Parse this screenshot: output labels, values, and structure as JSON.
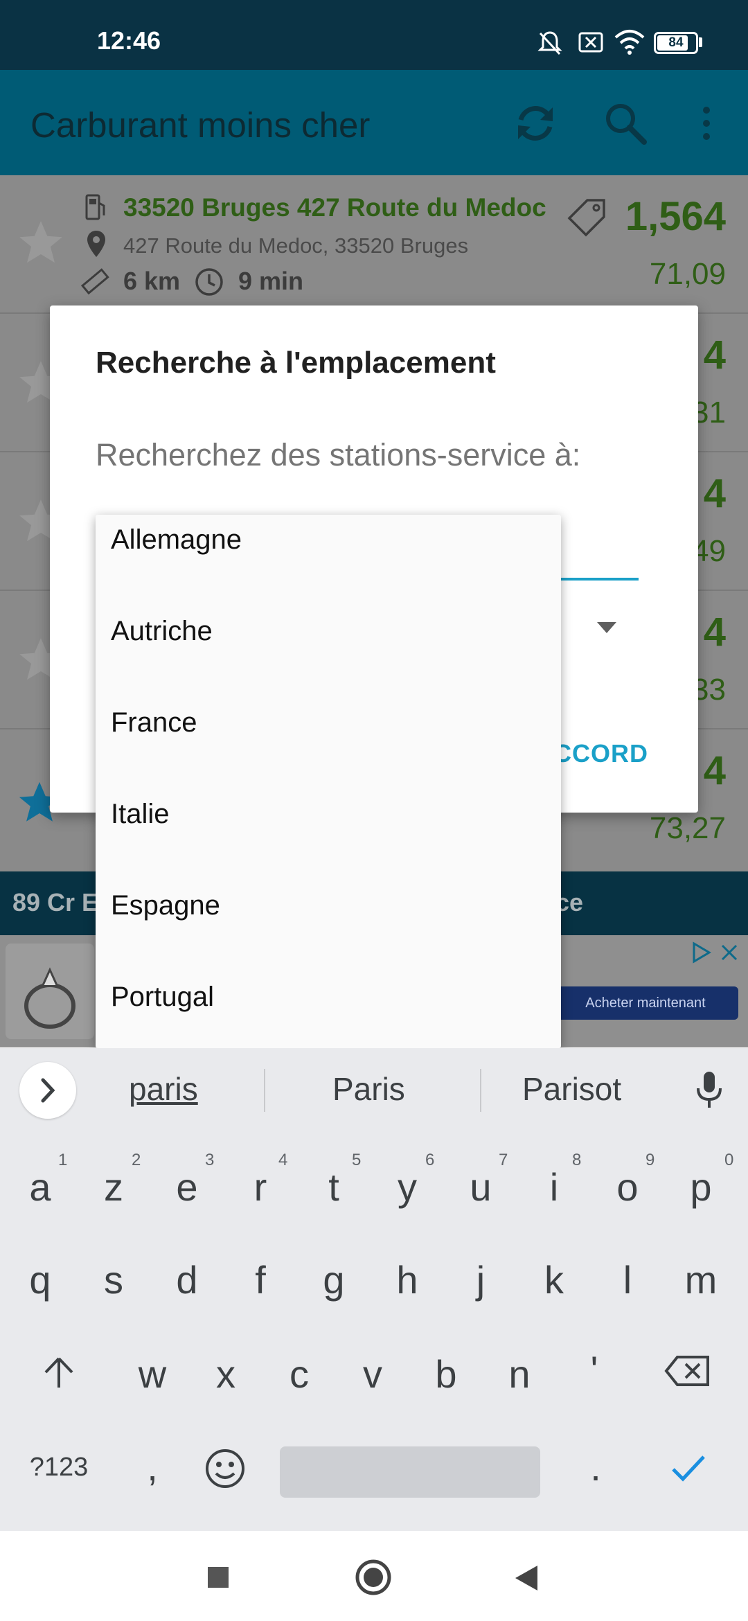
{
  "status": {
    "time": "12:46",
    "battery": "84"
  },
  "appbar": {
    "title": "Carburant moins cher"
  },
  "list": {
    "rows": [
      {
        "name": "33520 Bruges 427 Route du Medoc",
        "address": "427 Route du Medoc, 33520 Bruges",
        "distance": "6 km",
        "duration": "9 min",
        "price": "1,564",
        "total": "71,09",
        "favorite": false
      },
      {
        "price_fragment": "4",
        "total_fragment": "31",
        "favorite": false
      },
      {
        "price_fragment": "4",
        "total_fragment": "49",
        "favorite": false
      },
      {
        "price_fragment": "4",
        "total_fragment": "33",
        "favorite": false
      },
      {
        "price_fragment": "4",
        "total": "73,27",
        "favorite": true
      }
    ]
  },
  "bottom_bar": {
    "left_text": "89 Cr E",
    "right_text": "ce"
  },
  "ad": {
    "button_label": "Acheter maintenant"
  },
  "dialog": {
    "title": "Recherche à l'emplacement",
    "message": "Recherchez des stations-service à:",
    "ok_label": "ACCORD"
  },
  "dropdown": {
    "options": [
      "Allemagne",
      "Autriche",
      "France",
      "Italie",
      "Espagne",
      "Portugal"
    ]
  },
  "keyboard": {
    "suggestions": [
      "paris",
      "Paris",
      "Parisot"
    ],
    "row1": [
      "a",
      "z",
      "e",
      "r",
      "t",
      "y",
      "u",
      "i",
      "o",
      "p"
    ],
    "row1_nums": [
      "1",
      "2",
      "3",
      "4",
      "5",
      "6",
      "7",
      "8",
      "9",
      "0"
    ],
    "row2": [
      "q",
      "s",
      "d",
      "f",
      "g",
      "h",
      "j",
      "k",
      "l",
      "m"
    ],
    "row3": [
      "w",
      "x",
      "c",
      "v",
      "b",
      "n",
      "'"
    ],
    "symbols_label": "?123",
    "comma": ",",
    "period": "."
  },
  "colors": {
    "accent": "#1aa0c8",
    "appbar": "#005b75",
    "statusbar": "#0a3244",
    "price_green": "#2f5e16",
    "star_blue": "#0f7fb0"
  }
}
